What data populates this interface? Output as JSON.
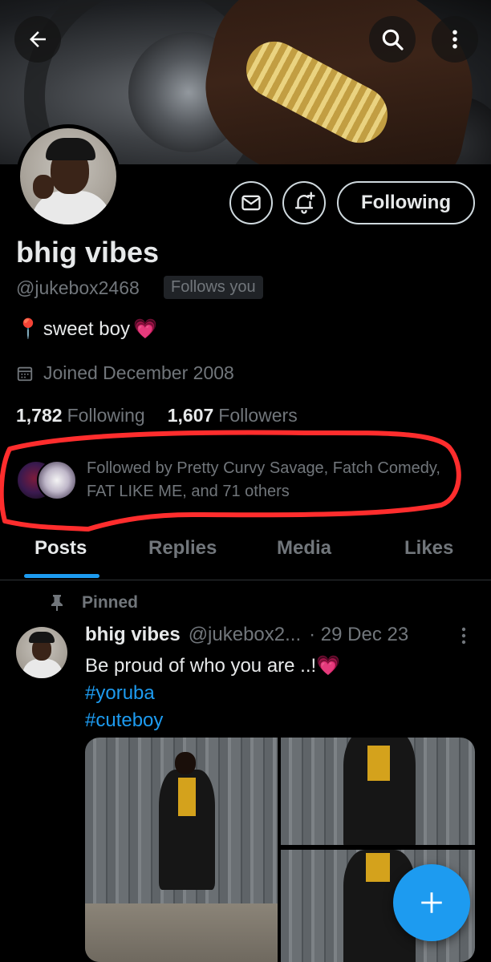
{
  "header": {
    "back_icon": "arrow-left-icon",
    "search_icon": "search-icon",
    "more_icon": "more-vertical-icon"
  },
  "profile": {
    "name": "bhig vibes",
    "handle": "@jukebox2468",
    "follows_you_badge": "Follows you",
    "bio_emoji_left": "📍",
    "bio_text": "sweet boy",
    "bio_emoji_right": "💗",
    "joined": "Joined December 2008",
    "following_count": "1,782",
    "following_label": "Following",
    "followers_count": "1,607",
    "followers_label": "Followers",
    "followed_by_text": "Followed by Pretty Curvy Savage, Fatch Comedy, FAT LIKE ME, and 71 others",
    "follow_button_label": "Following",
    "message_icon": "mail-icon",
    "notify_icon": "bell-plus-icon"
  },
  "tabs": [
    {
      "label": "Posts",
      "active": true
    },
    {
      "label": "Replies",
      "active": false
    },
    {
      "label": "Media",
      "active": false
    },
    {
      "label": "Likes",
      "active": false
    }
  ],
  "pinned_post": {
    "pinned_label": "Pinned",
    "author_name": "bhig vibes",
    "author_handle": "@jukebox2...",
    "date": "· 29 Dec 23",
    "text": "Be proud of who you are ..!💗",
    "hashtags": [
      "#yoruba",
      "#cuteboy"
    ]
  },
  "fab": {
    "icon": "plus-icon"
  },
  "colors": {
    "accent": "#1d9bf0",
    "annotation_red": "#ff2d2d",
    "muted_text": "#71767b",
    "primary_text": "#e7e9ea"
  }
}
